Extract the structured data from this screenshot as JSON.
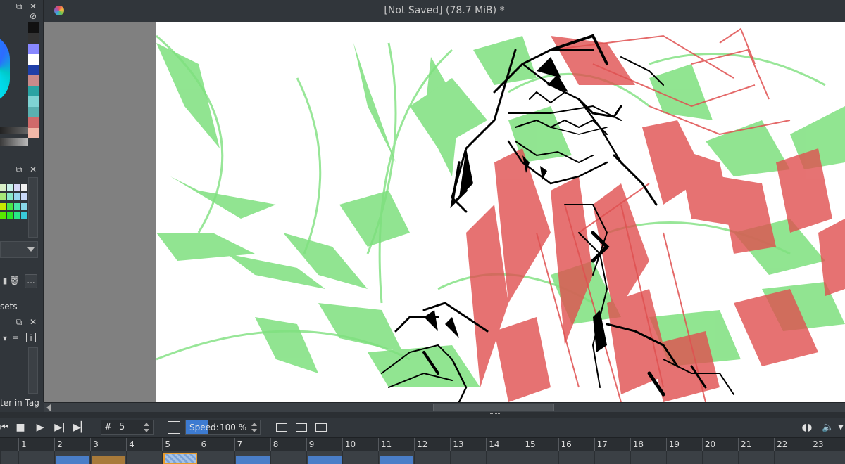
{
  "window": {
    "title": "[Not Saved]  (78.7 MiB) *",
    "app_icon": "krita-icon"
  },
  "left_dock": {
    "swatches": [
      "#111111",
      "#333333",
      "#8888ff",
      "#ffffff",
      "#1f3fa8",
      "#c98a8a",
      "#2aa3a3",
      "#7fd3d3",
      "#5ab0b0",
      "#d06a6a",
      "#f2b8a8"
    ],
    "palette_cells": [
      "#d9f0c8",
      "#c8f0e8",
      "#d8d8f8",
      "#f0f0f0",
      "#a8e878",
      "#88e8c8",
      "#98d8f0",
      "#c8d8f8",
      "#c8e800",
      "#48e848",
      "#48e8a8",
      "#88d8e8",
      "#58e800",
      "#28e828",
      "#28e888",
      "#38c8d8"
    ],
    "presets_tab": "sets",
    "tag_label": "ter in Tag",
    "more_button": "..."
  },
  "toolbar": {
    "frame_label": "#",
    "frame_value": "5",
    "speed_label": "Speed:",
    "speed_value": "100 %",
    "speed_fraction": 0.35
  },
  "timeline": {
    "frames": [
      "1",
      "2",
      "3",
      "4",
      "5",
      "6",
      "7",
      "8",
      "9",
      "10",
      "11",
      "12",
      "13",
      "14",
      "15",
      "16",
      "17",
      "18",
      "19",
      "20",
      "21",
      "22",
      "23"
    ],
    "current_frame": 5,
    "keyframe_colors": {
      "2": "#4a7ec8",
      "3": "#a87a3a",
      "5": "#7aa3d8",
      "7": "#4a7ec8",
      "9": "#4a7ec8",
      "11": "#4a7ec8"
    },
    "selection_color": "#e79a2b"
  },
  "colors": {
    "bg": "#31363b",
    "canvas_bg": "#808080",
    "sketch_green": "#7ee07e",
    "sketch_red": "#e05050",
    "ink": "#000000"
  }
}
